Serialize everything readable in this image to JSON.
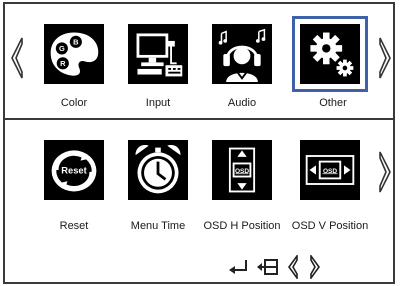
{
  "top_row": {
    "items": [
      {
        "label": "Color",
        "icon": "palette-icon"
      },
      {
        "label": "Input",
        "icon": "computer-input-icon"
      },
      {
        "label": "Audio",
        "icon": "headphones-music-icon"
      },
      {
        "label": "Other",
        "icon": "gears-icon",
        "selected": true
      }
    ]
  },
  "color_icon_letters": [
    "G",
    "B",
    "R"
  ],
  "bottom_row": {
    "items": [
      {
        "label": "Reset",
        "icon": "reset-icon",
        "badge": "Reset"
      },
      {
        "label": "Menu Time",
        "icon": "alarm-clock-icon"
      },
      {
        "label": "OSD H Position",
        "icon": "osd-h-position-icon",
        "badge": "OSD"
      },
      {
        "label": "OSD V Position",
        "icon": "osd-v-position-icon",
        "badge": "OSD"
      }
    ]
  },
  "nav_hints": [
    "enter-icon",
    "exit-icon",
    "left-icon",
    "right-icon"
  ],
  "colors": {
    "selection": "#3d62a8",
    "frame": "#3a3a3a",
    "tile": "#000000"
  }
}
